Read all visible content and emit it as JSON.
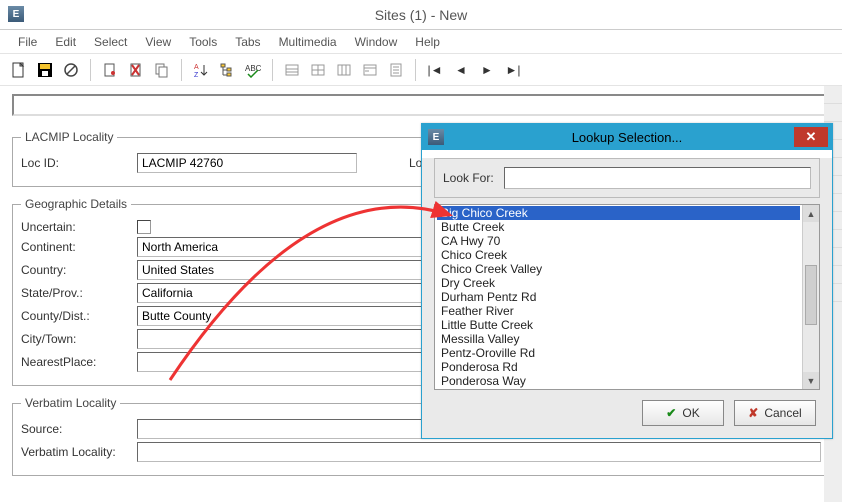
{
  "window": {
    "title": "Sites (1) - New"
  },
  "menu": {
    "items": [
      "File",
      "Edit",
      "Select",
      "View",
      "Tools",
      "Tabs",
      "Multimedia",
      "Window",
      "Help"
    ]
  },
  "group_lacmip": {
    "legend": "LACMIP Locality",
    "loc_id_label": "Loc ID:",
    "loc_id_value": "LACMIP 42760",
    "loc_summary_label": "Loc. Summary"
  },
  "group_geo": {
    "legend": "Geographic Details",
    "uncertain_label": "Uncertain:",
    "continent_label": "Continent:",
    "continent_value": "North America",
    "country_label": "Country:",
    "country_value": "United States",
    "state_label": "State/Prov.:",
    "state_value": "California",
    "county_label": "County/Dist.:",
    "county_value": "Butte County",
    "city_label": "City/Town:",
    "city_value": "",
    "nearest_label": "NearestPlace:",
    "nearest_value": ""
  },
  "group_verbatim": {
    "legend": "Verbatim Locality",
    "source_label": "Source:",
    "source_value": "",
    "verbatim_label": "Verbatim Locality:",
    "verbatim_value": ""
  },
  "dialog": {
    "title": "Lookup Selection...",
    "lookfor_label": "Look For:",
    "lookfor_value": "",
    "ok_label": "OK",
    "cancel_label": "Cancel",
    "items": [
      "Big Chico Creek",
      "Butte Creek",
      "CA Hwy 70",
      "Chico Creek",
      "Chico Creek Valley",
      "Dry Creek",
      "Durham Pentz Rd",
      "Feather River",
      "Little Butte Creek",
      "Messilla Valley",
      "Pentz-Oroville Rd",
      "Ponderosa Rd",
      "Ponderosa Way"
    ],
    "selected_index": 0
  }
}
